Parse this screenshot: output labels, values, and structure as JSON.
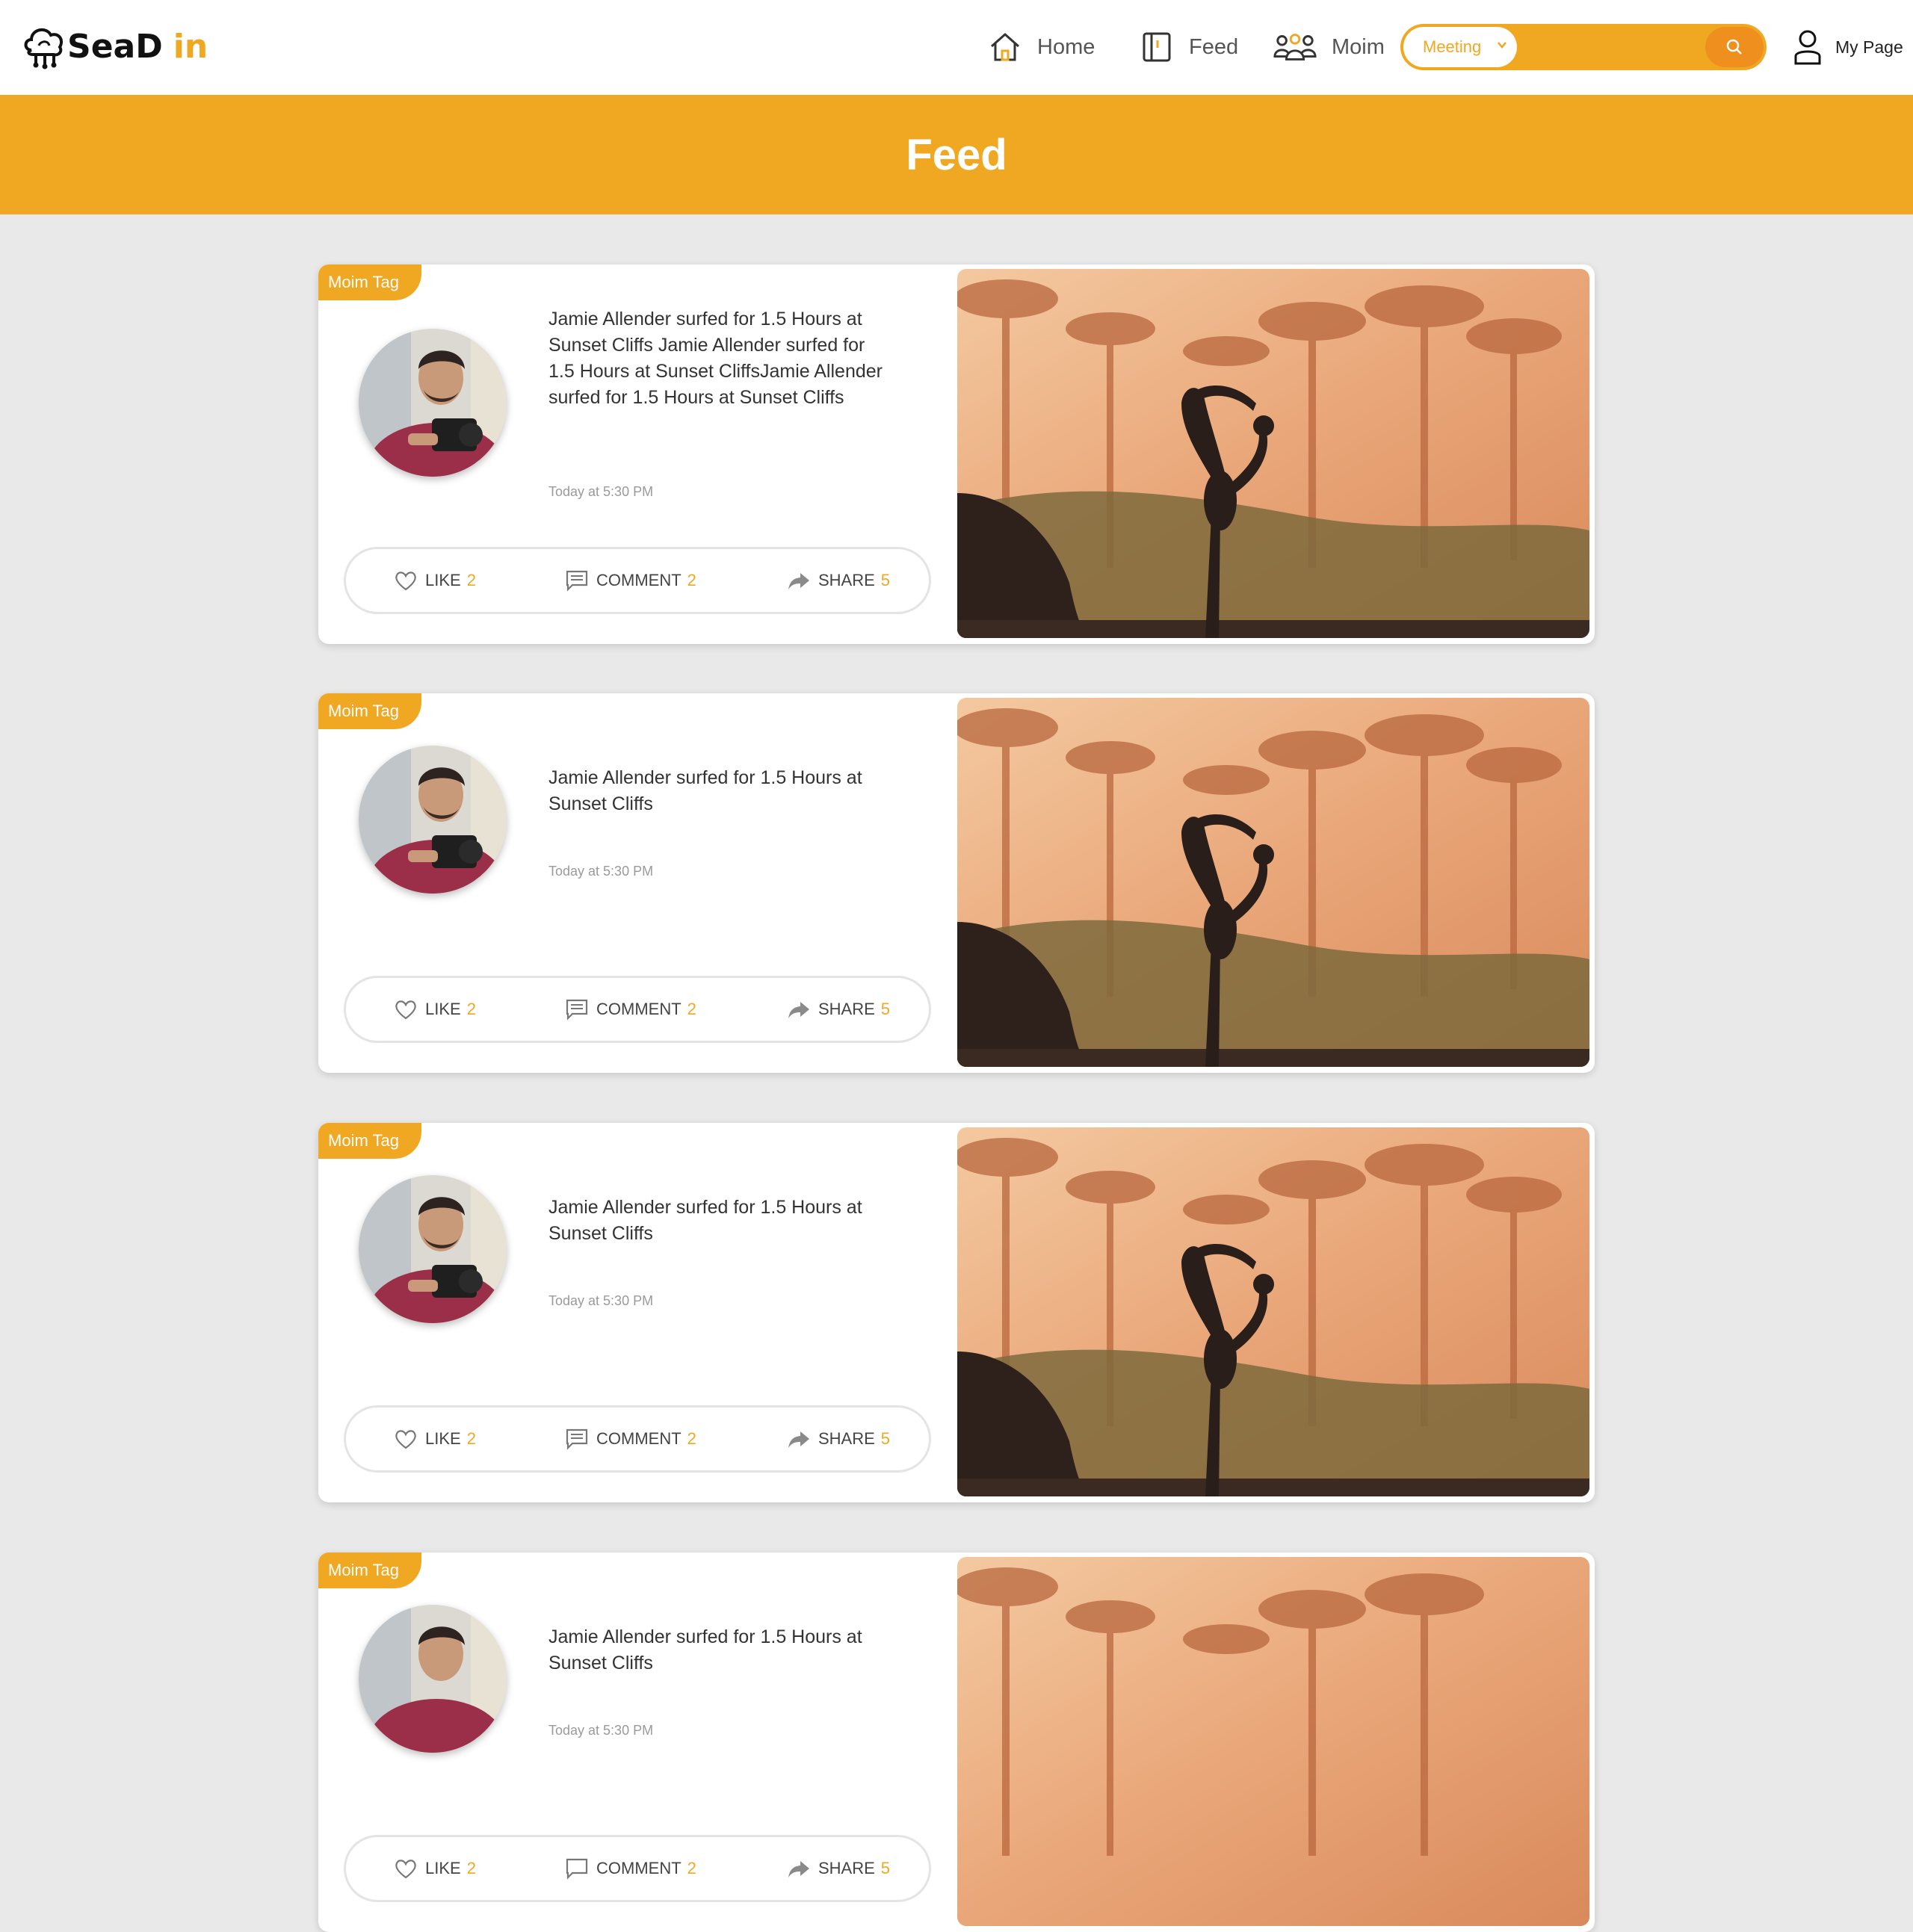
{
  "header": {
    "logo_text": "SeaD",
    "logo_accent": "in",
    "nav": [
      {
        "label": "Home",
        "icon": "home-icon"
      },
      {
        "label": "Feed",
        "icon": "book-icon"
      },
      {
        "label": "Moim",
        "icon": "group-icon"
      }
    ],
    "search": {
      "category": "Meeting",
      "placeholder": ""
    },
    "my_page_label": "My Page"
  },
  "banner": {
    "title": "Feed"
  },
  "posts": [
    {
      "tag": "Moim Tag",
      "text": "Jamie Allender surfed for 1.5 Hours at Sunset Cliffs Jamie Allender surfed for 1.5 Hours at Sunset CliffsJamie Allender surfed for 1.5 Hours at Sunset Cliffs",
      "time": "Today at 5:30 PM",
      "like_label": "LIKE",
      "like_count": "2",
      "comment_label": "COMMENT",
      "comment_count": "2",
      "share_label": "SHARE",
      "share_count": "5"
    },
    {
      "tag": "Moim Tag",
      "text": "Jamie Allender surfed for 1.5 Hours at Sunset Cliffs",
      "time": "Today at 5:30 PM",
      "like_label": "LIKE",
      "like_count": "2",
      "comment_label": "COMMENT",
      "comment_count": "2",
      "share_label": "SHARE",
      "share_count": "5"
    },
    {
      "tag": "Moim Tag",
      "text": "Jamie Allender surfed for 1.5 Hours at Sunset Cliffs",
      "time": "Today at 5:30 PM",
      "like_label": "LIKE",
      "like_count": "2",
      "comment_label": "COMMENT",
      "comment_count": "2",
      "share_label": "SHARE",
      "share_count": "5"
    },
    {
      "tag": "Moim Tag",
      "text": "Jamie Allender surfed for 1.5 Hours at Sunset Cliffs",
      "time": "Today at 5:30 PM",
      "like_label": "LIKE",
      "like_count": "2",
      "comment_label": "COMMENT",
      "comment_count": "2",
      "share_label": "SHARE",
      "share_count": "5"
    }
  ],
  "colors": {
    "accent": "#f0a823",
    "accent_dark": "#ee8f1e",
    "background": "#e9e9e9"
  }
}
